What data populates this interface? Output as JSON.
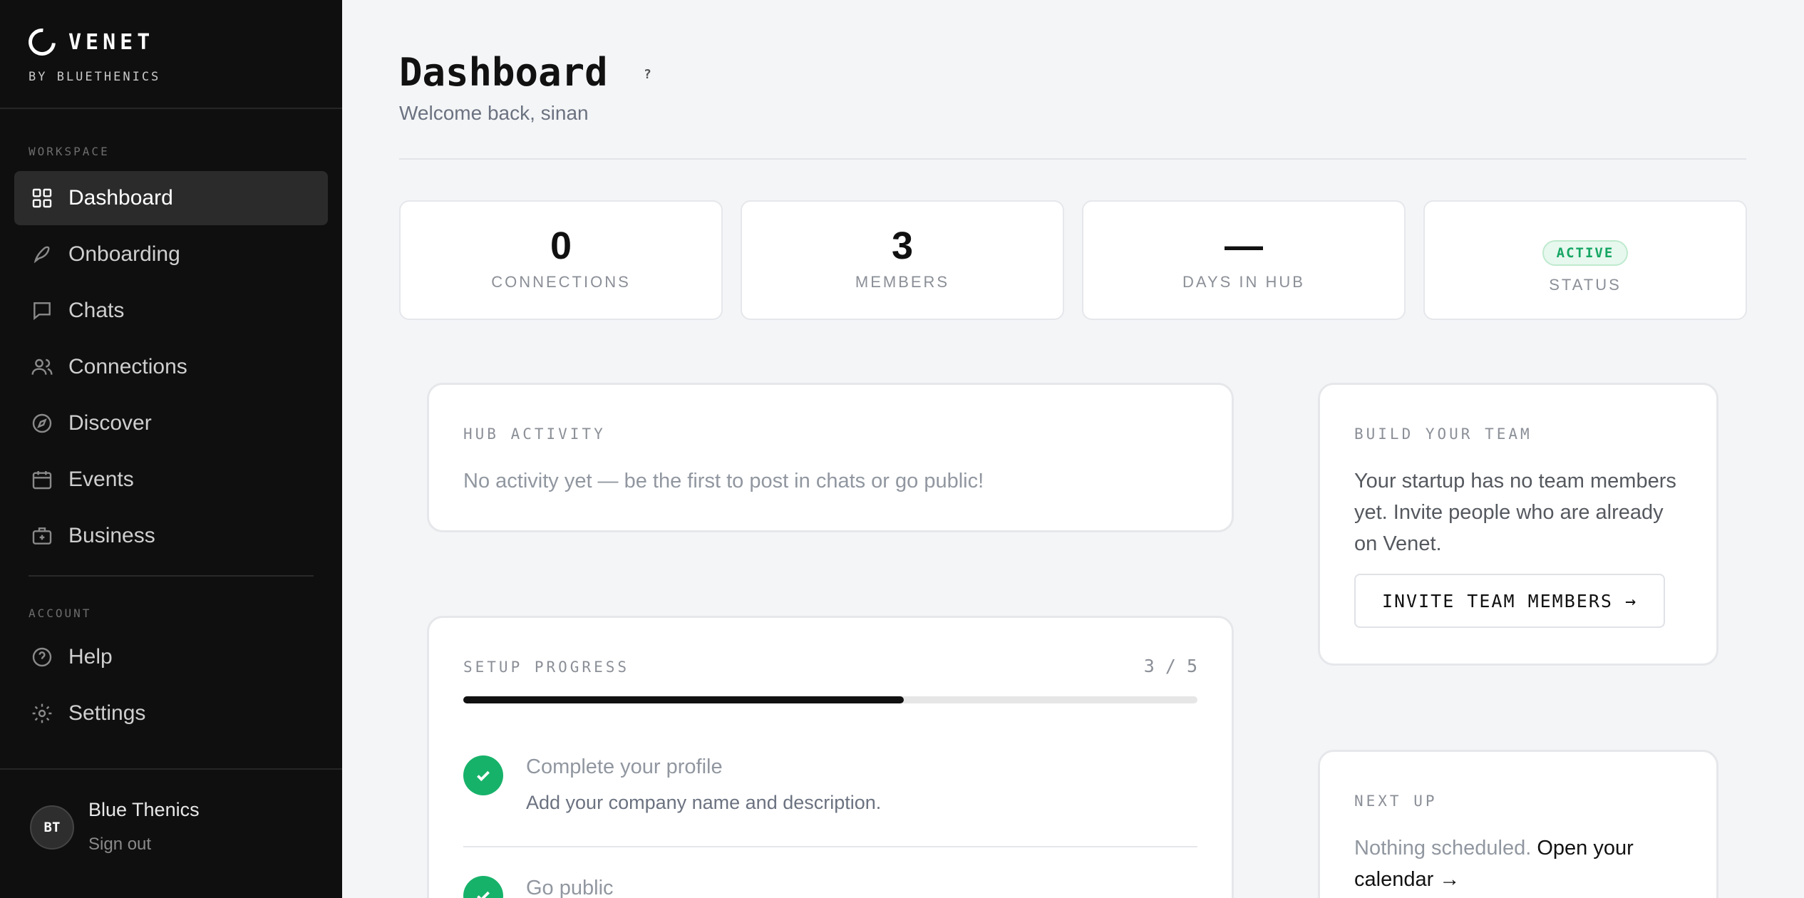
{
  "brand": {
    "name": "VENET",
    "subtitle": "BY BLUETHENICS"
  },
  "sidebar": {
    "workspace_label": "WORKSPACE",
    "workspace_items": [
      {
        "label": "Dashboard",
        "icon": "grid-icon",
        "active": true
      },
      {
        "label": "Onboarding",
        "icon": "rocket-icon"
      },
      {
        "label": "Chats",
        "icon": "chat-bubble-icon"
      },
      {
        "label": "Connections",
        "icon": "users-icon"
      },
      {
        "label": "Discover",
        "icon": "compass-icon"
      },
      {
        "label": "Events",
        "icon": "calendar-icon"
      },
      {
        "label": "Business",
        "icon": "briefcase-icon"
      }
    ],
    "account_label": "ACCOUNT",
    "account_items": [
      {
        "label": "Help",
        "icon": "help-circle-icon"
      },
      {
        "label": "Settings",
        "icon": "gear-icon"
      }
    ]
  },
  "user": {
    "initials": "BT",
    "name": "Blue Thenics",
    "sign_out": "Sign out"
  },
  "header": {
    "title": "Dashboard",
    "help": "?",
    "welcome": "Welcome back, sinan"
  },
  "stats": [
    {
      "value": "0",
      "label": "CONNECTIONS"
    },
    {
      "value": "3",
      "label": "MEMBERS"
    },
    {
      "value": "—",
      "label": "DAYS IN HUB"
    },
    {
      "badge": "ACTIVE",
      "label": "STATUS"
    }
  ],
  "hub_activity": {
    "label": "HUB ACTIVITY",
    "empty": "No activity yet — be the first to post in chats or go public!"
  },
  "setup": {
    "label": "SETUP PROGRESS",
    "count": "3 / 5",
    "progress": 0.6,
    "steps": [
      {
        "title": "Complete your profile",
        "desc": "Add your company name and description.",
        "done": true
      },
      {
        "title": "Go public",
        "done": true
      }
    ]
  },
  "team": {
    "label": "BUILD YOUR TEAM",
    "text": "Your startup has no team members yet. Invite people who are already on Venet.",
    "button": "INVITE TEAM MEMBERS →"
  },
  "next_up": {
    "label": "NEXT UP",
    "empty": "Nothing scheduled.",
    "link": "Open your calendar →"
  },
  "colors": {
    "sidebar_bg": "#0f0f0f",
    "accent_green": "#17b26a",
    "page_bg": "#f4f5f7"
  }
}
